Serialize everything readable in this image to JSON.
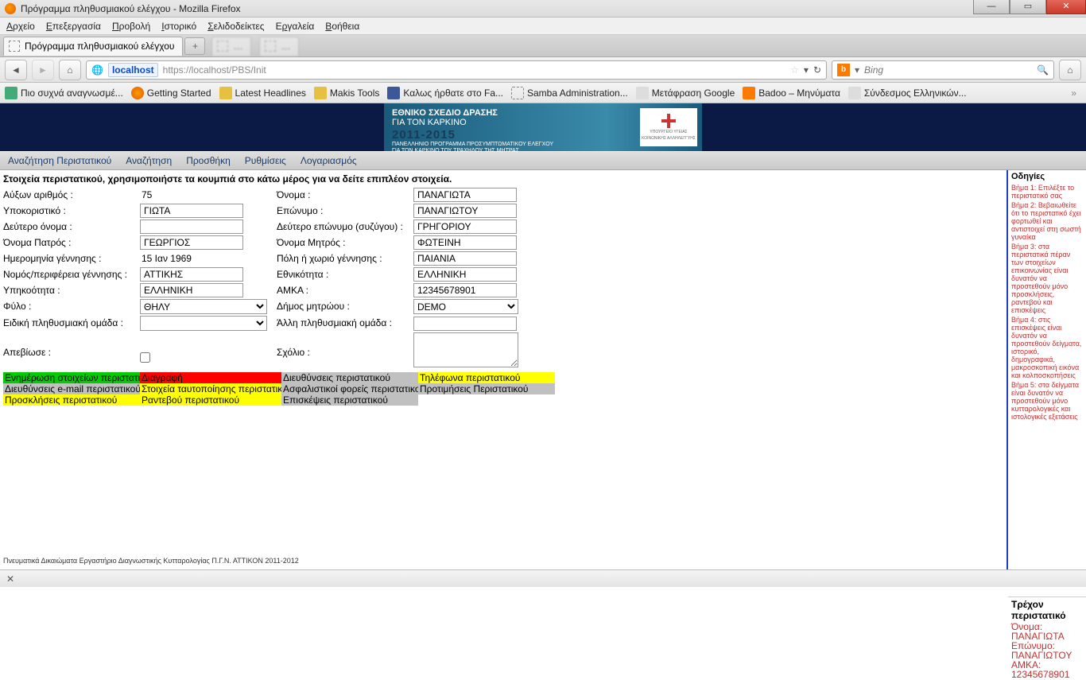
{
  "window": {
    "title": "Πρόγραμμα πληθυσμιακού ελέγχου - Mozilla Firefox"
  },
  "menubar": [
    "Αρχείο",
    "Επεξεργασία",
    "Προβολή",
    "Ιστορικό",
    "Σελιδοδείκτες",
    "Εργαλεία",
    "Βοήθεια"
  ],
  "tab": {
    "title": "Πρόγραμμα πληθυσμιακού ελέγχου"
  },
  "url": {
    "host": "localhost",
    "path": "https://localhost/PBS/Init"
  },
  "search": {
    "placeholder": "Bing"
  },
  "bookmarks": [
    "Πιο συχνά αναγνωσμέ...",
    "Getting Started",
    "Latest Headlines",
    "Makis Tools",
    "Καλως ήρθατε στο Fa...",
    "Samba Administration...",
    "Μετάφραση Google",
    "Badoo – Μηνύματα",
    "Σύνδεσμος Ελληνικών..."
  ],
  "banner": {
    "l1": "ΕΘΝΙΚΟ ΣΧΕΔΙΟ ΔΡΑΣΗΣ",
    "l2": "ΓΙΑ ΤΟΝ ΚΑΡΚΙΝΟ",
    "years": "2011-2015",
    "s1": "ΠΑΝΕΛΛΗΝΙΟ ΠΡΟΓΡΑΜΜΑ ΠΡΟΣΥΜΠΤΩΜΑΤΙΚΟΥ ΕΛΕΓΧΟΥ",
    "s2": "ΓΙΑ ΤΟΝ ΚΑΡΚΙΝΟ ΤΟΥ ΤΡΑΧΗΛΟΥ ΤΗΣ ΜΗΤΡΑΣ",
    "logo1": "ΥΠΟΥΡΓΕΙΟ ΥΓΕΙΑΣ",
    "logo2": "ΚΟΙΝΩΝΙΚΗΣ ΑΛΛΗΛΕΓΓΥΗΣ"
  },
  "appmenu": [
    "Αναζήτηση Περιστατικού",
    "Αναζήτηση",
    "Προσθήκη",
    "Ρυθμίσεις",
    "Λογαριασμός"
  ],
  "instr": "Στοιχεία περιστατικού, χρησιμοποιήστε τα κουμπιά στο κάτω μέρος για να δείτε επιπλέον στοιχεία.",
  "form": {
    "l_id": "Αύξων αριθμός :",
    "v_id": "75",
    "l_name": "Όνομα :",
    "v_name": "ΠΑΝΑΓΙΩΤΑ",
    "l_nick": "Υποκοριστικό :",
    "v_nick": "ΓΙΩΤΑ",
    "l_surname": "Επώνυμο :",
    "v_surname": "ΠΑΝΑΓΙΩΤΟΥ",
    "l_name2": "Δεύτερο όνομα :",
    "v_name2": "",
    "l_surname2": "Δεύτερο επώνυμο (συζύγου) :",
    "v_surname2": "ΓΡΗΓΟΡΙΟΥ",
    "l_father": "Όνομα Πατρός :",
    "v_father": "ΓΕΩΡΓΙΟΣ",
    "l_mother": "Όνομα Μητρός :",
    "v_mother": "ΦΩΤΕΙΝΗ",
    "l_dob": "Ημερομηνία γέννησης :",
    "v_dob": "15 Ιαν 1969",
    "l_pob": "Πόλη ή χωριό γέννησης :",
    "v_pob": "ΠΑΙΑΝΙΑ",
    "l_region": "Νομός/περιφέρεια γέννησης :",
    "v_region": "ΑΤΤΙΚΗΣ",
    "l_nat": "Εθνικότητα :",
    "v_nat": "ΕΛΛΗΝΙΚΗ",
    "l_cit": "Υπηκοότητα :",
    "v_cit": "ΕΛΛΗΝΙΚΗ",
    "l_amka": "ΑΜΚΑ :",
    "v_amka": "12345678901",
    "l_sex": "Φύλο :",
    "v_sex": "ΘΗΛΥ",
    "l_dimos": "Δήμος μητρώου :",
    "v_dimos": "DEMO",
    "l_grp": "Ειδική πληθυσμιακή ομάδα :",
    "v_grp": "",
    "l_grp2": "Άλλη πληθυσμιακή ομάδα :",
    "v_grp2": "",
    "l_dead": "Απεβίωσε :",
    "l_note": "Σχόλιο :"
  },
  "actions": {
    "r1c1": "Ενημέρωση στοιχείων περιστατικού",
    "r1c2": "Διαγραφή",
    "r1c3": "Διευθύνσεις περιστατικού",
    "r1c4": "Τηλέφωνα περιστατικού",
    "r2c1": "Διευθύνσεις e-mail περιστατικού",
    "r2c2": "Στοιχεία ταυτοποίησης περιστατικού",
    "r2c3": "Ασφαλιστικοί φορείς περιστατικού",
    "r2c4": "Προτιμήσεις Περιστατικού",
    "r3c1": "Προσκλήσεις περιστατικού",
    "r3c2": "Ραντεβού περιστατικού",
    "r3c3": "Επισκέψεις περιστατικού"
  },
  "sidebar": {
    "title": "Οδηγίες",
    "s1": "Βήμα 1: Επιλέξτε το περιστατικό σας",
    "s2": "Βήμα 2: Βεβαιωθείτε ότι το περιστατικό έχει φορτωθεί και αντιστοιχεί στη σωστή γυναίκα",
    "s3": "Βήμα 3: στα περιστατικά πέραν των στοιχείων επικοινωνίας είναι δυνατόν να προστεθούν μόνο προσκλήσεις, ραντεβού και επισκέψεις",
    "s4": "Βήμα 4: στις επισκέψεις είναι δυνατόν να προστεθούν δείγματα, ιστορικό, δημογραφικά, μακροσκοπική εικόνα και κολποσκοπήσεις",
    "s5": "Βήμα 5: στα δείγματα είναι δυνατόν να προστεθούν μόνο κυτταρολογικές και ιστολογικές εξετάσεις",
    "curr_t": "Τρέχον περιστατικό",
    "curr_name_l": "Όνομα:",
    "curr_name_v": "ΠΑΝΑΓΙΩΤΑ",
    "curr_sur_l": "Επώνυμο:",
    "curr_sur_v": "ΠΑΝΑΓΙΩΤΟΥ",
    "curr_amka_l": "ΑΜΚΑ:",
    "curr_amka_v": "12345678901"
  },
  "footer": "Πνευματικά Δικαιώματα Εργαστήριο Διαγνωστικής Κυτταρολογίας Π.Γ.Ν. ΑΤΤΙΚΟΝ 2011-2012"
}
